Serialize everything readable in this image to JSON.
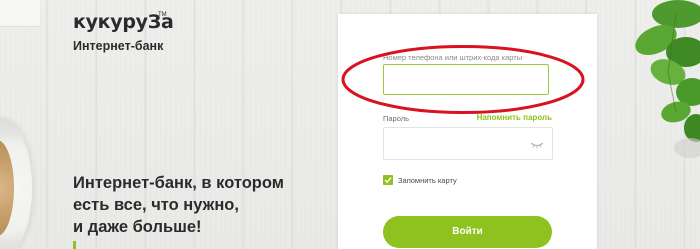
{
  "brand": {
    "logo_text": "кукуруЗа",
    "trademark": "TM",
    "subtitle": "Интернет-банк"
  },
  "promo": {
    "headline_lines": [
      "Интернет-банк, в котором",
      "есть все, что нужно,",
      "и даже больше!"
    ]
  },
  "login": {
    "phone_label": "Номер телефона или штрих-кода карты",
    "phone_value": "",
    "password_label": "Пароль",
    "password_value": "",
    "remind_password": "Напомнить пароль",
    "remember_label": "Запомнить карту",
    "remember_checked": true,
    "submit_label": "Войти"
  },
  "colors": {
    "accent_green": "#8dc21f",
    "input_focus_border": "#9bcb3b",
    "annotation_red": "#d9121f",
    "text_dark": "#2b2b2b"
  },
  "icons": [
    "eye-icon",
    "checkmark-icon"
  ]
}
